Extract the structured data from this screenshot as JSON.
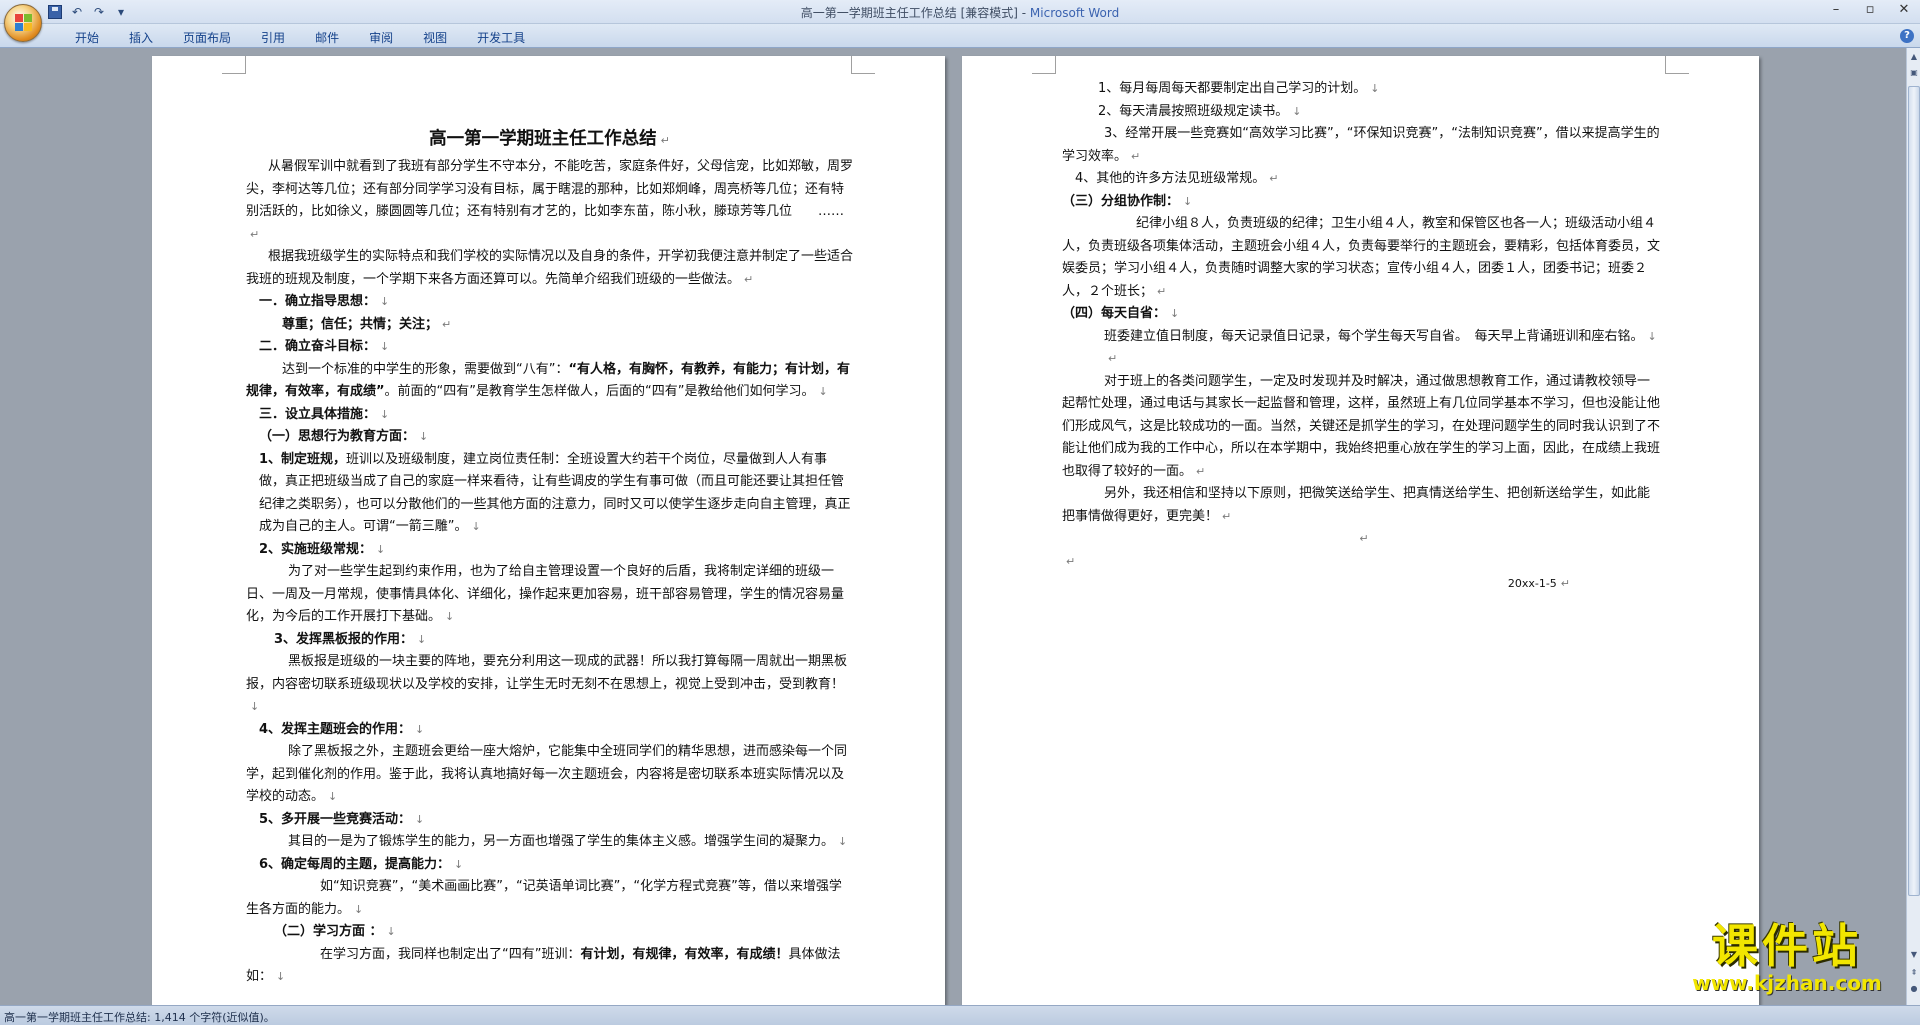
{
  "window": {
    "title": "高一第一学期班主任工作总结 [兼容模式] - ",
    "app_name": "Microsoft Word",
    "controls": [
      "–",
      "▫",
      "✕"
    ]
  },
  "quick_access": {
    "save_icon": "save-icon",
    "undo_glyph": "↶",
    "redo_glyph": "↷",
    "customize_glyph": "▾"
  },
  "ribbon": {
    "tabs": [
      "开始",
      "插入",
      "页面布局",
      "引用",
      "邮件",
      "审阅",
      "视图",
      "开发工具"
    ],
    "help": "?"
  },
  "document": {
    "title": "高一第一学期班主任工作总结",
    "page1": [
      "从暑假军训中就看到了我班有部分学生不守本分，不能吃苦，家庭条件好，父母信宠，比如郑敏，周罗尖，李柯达等几位；还有部分同学学习没有目标，属于瞎混的那种，比如郑炯峰，周亮桥等几位；还有特别活跃的，比如徐义，滕圆圆等几位；还有特别有才艺的，比如李东苗，陈小秋，滕琼芳等几位　　……",
      "根据我班级学生的实际特点和我们学校的实际情况以及自身的条件，开学初我便注意并制定了一些适合我班的班规及制度，一个学期下来各方面还算可以。先简单介绍我们班级的一些做法。",
      "一．确立指导思想：",
      "尊重；信任；共情；关注；",
      "二．确立奋斗目标：",
      "达到一个标准的中学生的形象，需要做到“八有”：",
      "“有人格，有胸怀，有教养，有能力；有计划，有规律，有效率，有成绩”",
      "。前面的“四有”是教育学生怎样做人，后面的“四有”是教给他们如何学习。",
      "三．设立具体措施：",
      "（一）思想行为教育方面：",
      "1、制定班规，",
      "班训以及班级制度，建立岗位责任制：全班设置大约若干个岗位，尽量做到人人有事做，真正把班级当成了自己的家庭一样来看待，让有些调皮的学生有事可做（而且可能还要让其担任管纪律之类职务），也可以分散他们的一些其他方面的注意力，同时又可以使学生逐步走向自主管理，真正成为自己的主人。可谓“一箭三雕”。",
      "2、实施班级常规：",
      "为了对一些学生起到约束作用，也为了给自主管理设置一个良好的后盾，我将制定详细的班级一日、一周及一月常规，使事情具体化、详细化，操作起来更加容易，班干部容易管理，学生的情况容易量化，为今后的工作开展打下基础。",
      "3、发挥黑板报的作用：",
      "黑板报是班级的一块主要的阵地，要充分利用这一现成的武器！所以我打算每隔一周就出一期黑板报，内容密切联系班级现状以及学校的安排，让学生无时无刻不在思想上，视觉上受到冲击，受到教育！",
      "4、发挥主题班会的作用：",
      "除了黑板报之外，主题班会更给一座大熔炉，它能集中全班同学们的精华思想，进而感染每一个同学，起到催化剂的作用。鉴于此，我将认真地搞好每一次主题班会，内容将是密切联系本班实际情况以及学校的动态。",
      "5、多开展一些竞赛活动：",
      "其目的一是为了锻炼学生的能力，另一方面也增强了学生的集体主义感。增强学生间的凝聚力。",
      "6、确定每周的主题，提高能力：",
      "如“知识竞赛”，“美术画画比赛”，“记英语单词比赛”，“化学方程式竞赛”等，借以来增强学生各方面的能力。",
      "（二）学习方面 ：",
      "在学习方面，我同样也制定出了“四有”班训：",
      "有计划，有规律，有效率，有成绩！",
      "具体做法如："
    ],
    "page2": [
      "1、每月每周每天都要制定出自己学习的计划。",
      "2、每天清晨按照班级规定读书。",
      "3、经常开展一些竞赛如“高效学习比赛”，“环保知识竞赛”，“法制知识竞赛”，借以来提高学生的学习效率。",
      "4、其他的许多方法见班级常规。",
      "（三）分组协作制：",
      "纪律小组８人，负责班级的纪律；卫生小组４人，教室和保管区也各一人；班级活动小组４人，负责班级各项集体活动，主题班会小组４人，负责每要举行的主题班会，要精彩，包括体育委员，文娱委员；学习小组４人，负责随时调整大家的学习状态；宣传小组４人，团委１人，团委书记；班委２人，２个班长；",
      "（四）每天自省：",
      "班委建立值日制度，每天记录值日记录，每个学生每天写自省。　每天早上背诵班训和座右铭。",
      "对于班上的各类问题学生，一定及时发现并及时解决，通过做思想教育工作，通过请教校领导一起帮忙处理，通过电话与其家长一起监督和管理，这样，虽然班上有几位同学基本不学习，但也没能让他们形成风气，这是比较成功的一面。当然，关键还是抓学生的学习，在处理问题学生的同时我认识到了不能让他们成为我的工作中心，所以在本学期中，我始终把重心放在学生的学习上面，因此，在成绩上我班也取得了较好的一面。",
      "另外，我还相信和坚持以下原则，把微笑送给学生、把真情送给学生、把创新送给学生，如此能把事情做得更好，更完美！",
      "20xx-1-5"
    ]
  },
  "status_bar": {
    "text": "高一第一学期班主任工作总结: 1,414 个字符(近似值)。"
  },
  "watermark": {
    "cn": "课件站",
    "url": "www.kjzhan.com"
  },
  "colors": {
    "ribbon_text": "#15428b",
    "watermark": "#f2e600",
    "app_title": "#3b63b0"
  }
}
